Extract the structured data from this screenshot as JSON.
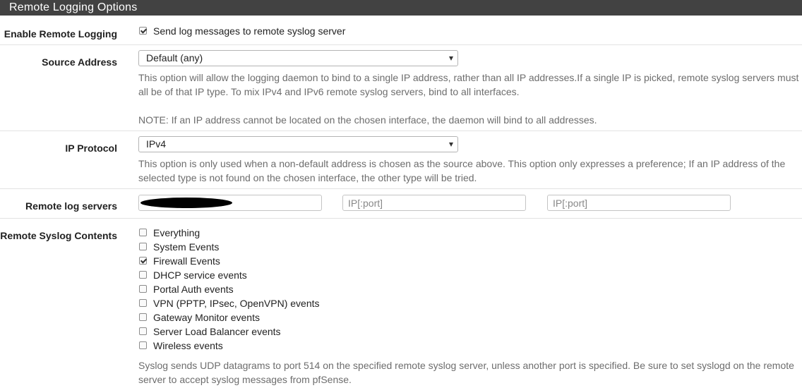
{
  "panel": {
    "title": "Remote Logging Options"
  },
  "enable_remote_logging": {
    "label": "Enable Remote Logging",
    "checkbox_label": "Send log messages to remote syslog server",
    "checked": true
  },
  "source_address": {
    "label": "Source Address",
    "selected": "Default (any)",
    "help_1": "This option will allow the logging daemon to bind to a single IP address, rather than all IP addresses.If a single IP is picked, remote syslog servers must all be of that IP type. To mix IPv4 and IPv6 remote syslog servers, bind to all interfaces.",
    "help_2": "NOTE: If an IP address cannot be located on the chosen interface, the daemon will bind to all addresses."
  },
  "ip_protocol": {
    "label": "IP Protocol",
    "selected": "IPv4",
    "help": "This option is only used when a non-default address is chosen as the source above. This option only expresses a preference; If an IP address of the selected type is not found on the chosen interface, the other type will be tried."
  },
  "remote_log_servers": {
    "label": "Remote log servers",
    "server1_value": "",
    "server2_placeholder": "IP[:port]",
    "server3_placeholder": "IP[:port]"
  },
  "remote_syslog_contents": {
    "label": "Remote Syslog Contents",
    "items": [
      {
        "label": "Everything",
        "checked": false
      },
      {
        "label": "System Events",
        "checked": false
      },
      {
        "label": "Firewall Events",
        "checked": true
      },
      {
        "label": "DHCP service events",
        "checked": false
      },
      {
        "label": "Portal Auth events",
        "checked": false
      },
      {
        "label": "VPN (PPTP, IPsec, OpenVPN) events",
        "checked": false
      },
      {
        "label": "Gateway Monitor events",
        "checked": false
      },
      {
        "label": "Server Load Balancer events",
        "checked": false
      },
      {
        "label": "Wireless events",
        "checked": false
      }
    ],
    "help": "Syslog sends UDP datagrams to port 514 on the specified remote syslog server, unless another port is specified. Be sure to set syslogd on the remote server to accept syslog messages from pfSense."
  }
}
